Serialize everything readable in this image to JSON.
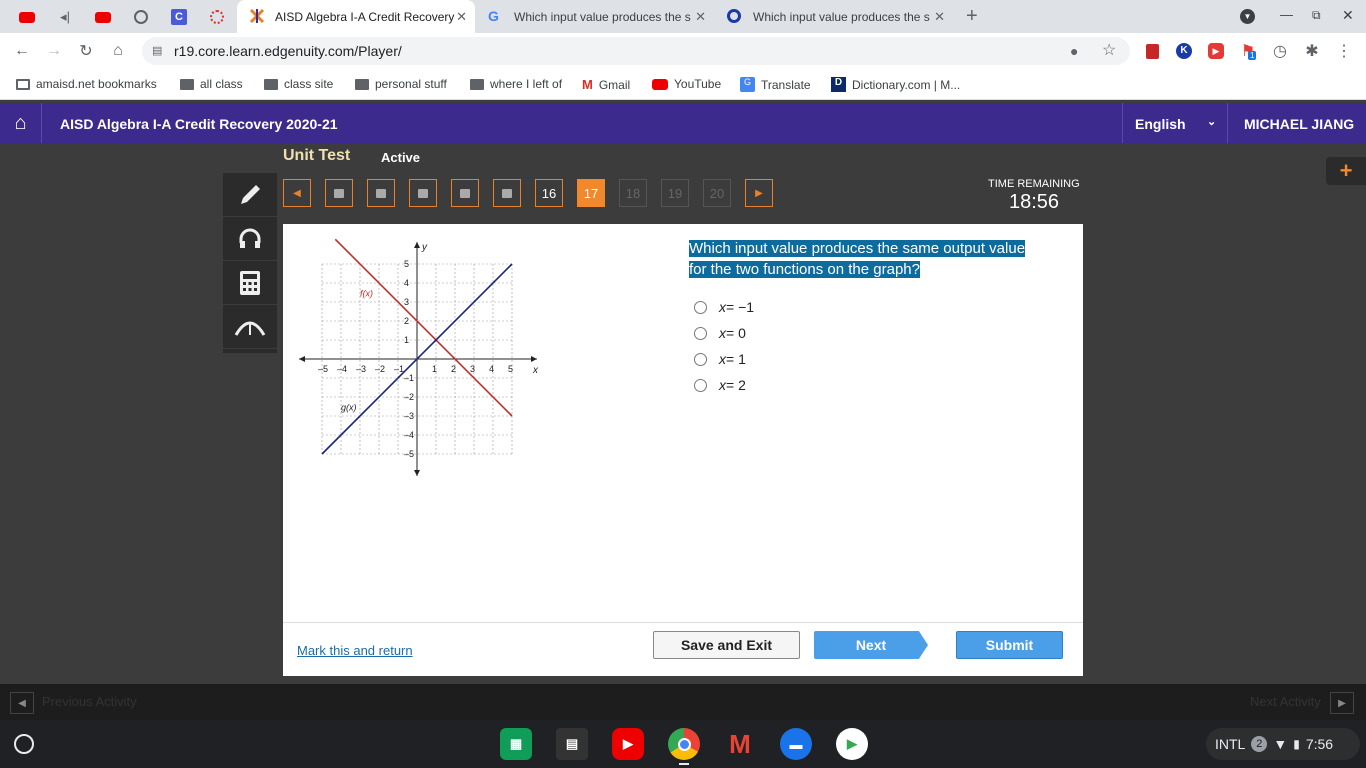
{
  "browser": {
    "tabs": [
      {
        "title": "AISD Algebra I-A Credit Recovery",
        "active": true
      },
      {
        "title": "Which input value produces the s",
        "active": false
      },
      {
        "title": "Which input value produces the s",
        "active": false
      }
    ],
    "url": "r19.core.learn.edgenuity.com/Player/",
    "bookmarks": [
      "amaisd.net bookmarks",
      "all class",
      "class site",
      "personal stuff",
      "where I left of",
      "Gmail",
      "YouTube",
      "Translate",
      "Dictionary.com | M..."
    ],
    "extension_badge": "1"
  },
  "app": {
    "course_title": "AISD Algebra I-A Credit Recovery 2020-21",
    "language": "English",
    "user": "MICHAEL JIANG",
    "section": "Unit Test",
    "status": "Active",
    "time_label": "TIME REMAINING",
    "time_value": "18:56"
  },
  "nav": {
    "questions": [
      "16",
      "17",
      "18",
      "19",
      "20"
    ],
    "current": "17"
  },
  "question": {
    "text": "Which input value produces the same output value for the two functions on the graph?",
    "options": [
      {
        "var": "x",
        "rest": " = −1"
      },
      {
        "var": "x",
        "rest": " = 0"
      },
      {
        "var": "x",
        "rest": " = 1"
      },
      {
        "var": "x",
        "rest": " = 2"
      }
    ]
  },
  "graph": {
    "x_label": "x",
    "y_label": "y",
    "x_ticks": [
      "–5",
      "–4",
      "–3",
      "–2",
      "–1",
      "1",
      "2",
      "3",
      "4",
      "5"
    ],
    "y_ticks": [
      "5",
      "4",
      "3",
      "2",
      "1",
      "–1",
      "–2",
      "–3",
      "–4",
      "–5"
    ],
    "f_label": "f(x)",
    "g_label": "g(x)",
    "f_color": "#cc2a2a",
    "g_color": "#1a237e"
  },
  "footer": {
    "mark_label": "Mark this and return",
    "save_label": "Save and Exit",
    "next_label": "Next",
    "submit_label": "Submit"
  },
  "activity": {
    "prev": "Previous Activity",
    "next": "Next Activity"
  },
  "shelf": {
    "ime": "INTL",
    "notifications": "2",
    "clock": "7:56"
  }
}
